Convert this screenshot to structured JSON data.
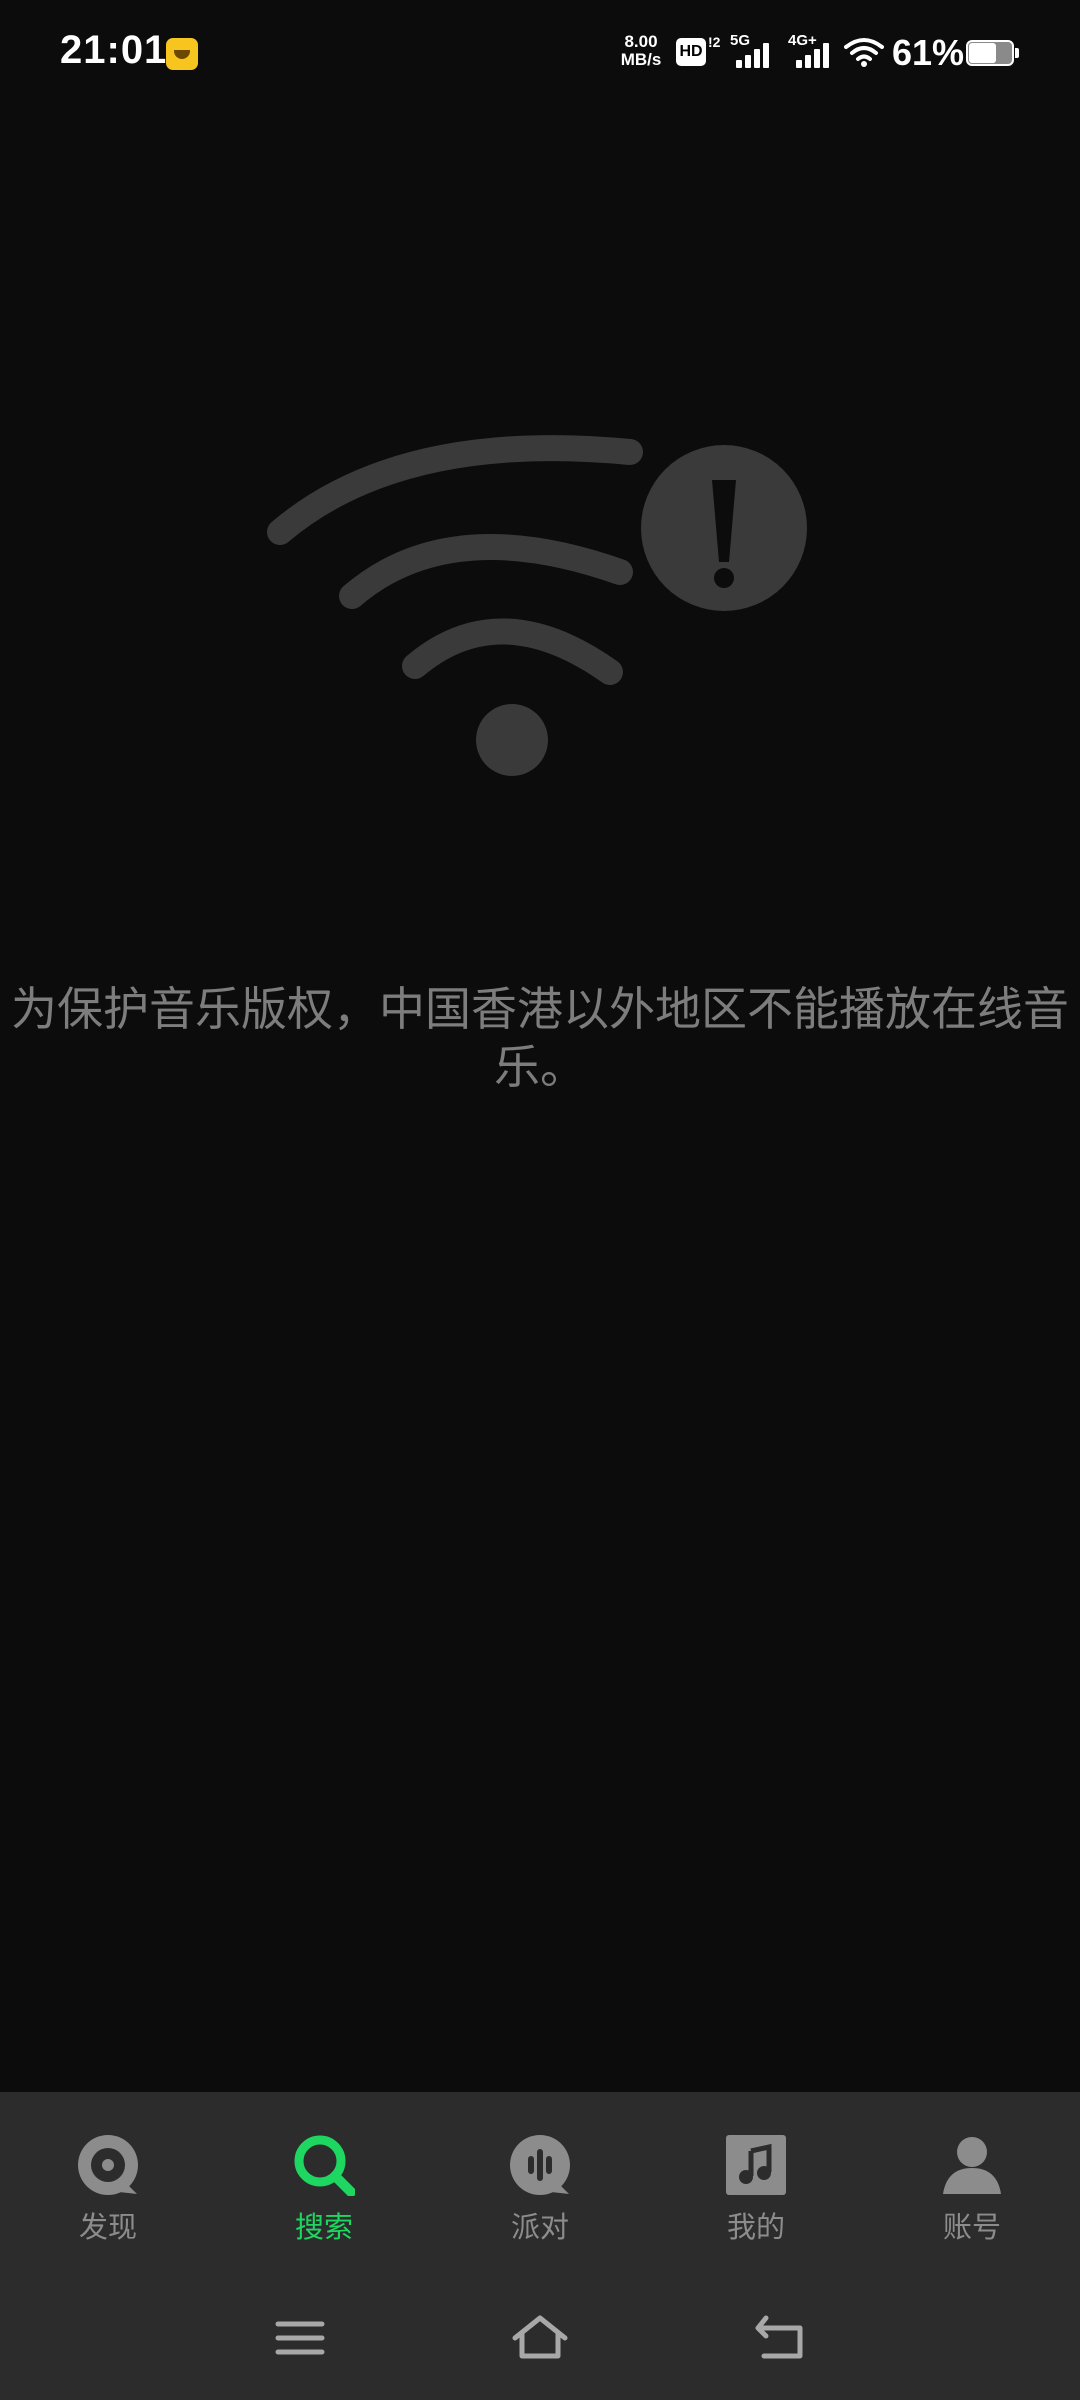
{
  "status_bar": {
    "time": "21:01",
    "net_speed_value": "8.00",
    "net_speed_unit": "MB/s",
    "hd_label": "HD",
    "hd_sub": "!2",
    "sim1_label": "5G",
    "sim2_label": "4G+",
    "battery_percent": "61%",
    "battery_level": 0.61
  },
  "main": {
    "error_message": "为保护音乐版权，中国香港以外地区不能播放在线音乐。"
  },
  "bottom_nav": {
    "active_color": "#1ed760",
    "inactive_color": "#8c8c8c",
    "items": [
      {
        "label": "发现",
        "icon": "disc-icon",
        "active": false
      },
      {
        "label": "搜索",
        "icon": "search-icon",
        "active": true
      },
      {
        "label": "派对",
        "icon": "party-icon",
        "active": false
      },
      {
        "label": "我的",
        "icon": "music-note-icon",
        "active": false
      },
      {
        "label": "账号",
        "icon": "person-icon",
        "active": false
      }
    ]
  },
  "system_nav": {
    "buttons": [
      "menu-icon",
      "home-icon",
      "back-icon"
    ]
  }
}
